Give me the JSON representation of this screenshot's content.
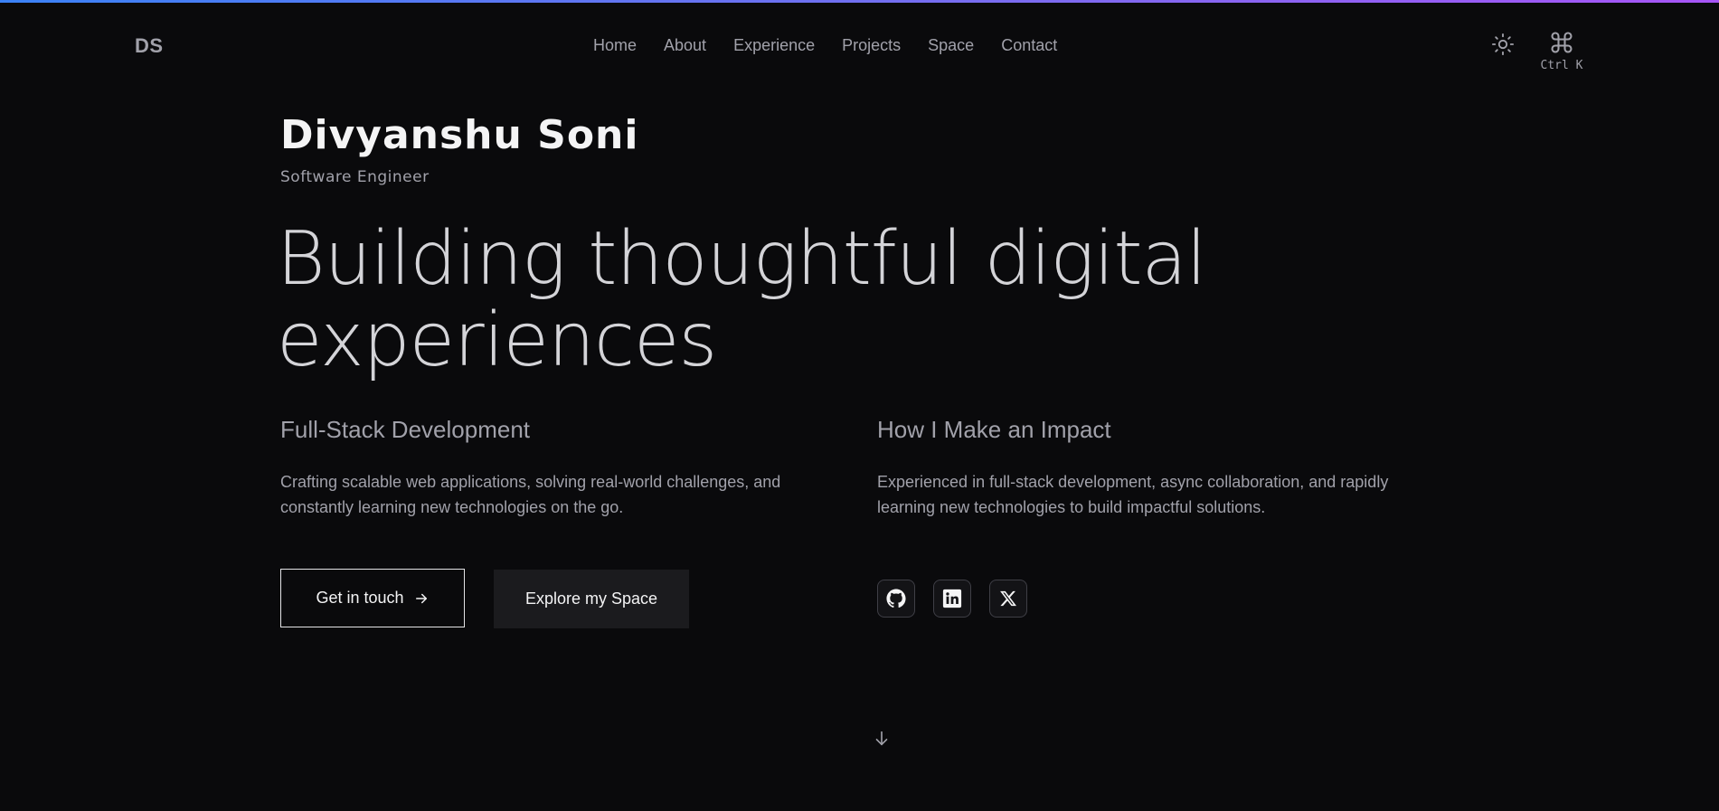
{
  "header": {
    "logo": "DS",
    "nav": [
      "Home",
      "About",
      "Experience",
      "Projects",
      "Space",
      "Contact"
    ],
    "theme_icon": "sun-icon",
    "command_icon": "command-icon",
    "command_shortcut": "Ctrl K"
  },
  "hero": {
    "name": "Divyanshu Soni",
    "role": "Software Engineer",
    "headline_line1": "Building thoughtful digital",
    "headline_line2": "experiences"
  },
  "columns": {
    "left": {
      "title": "Full-Stack Development",
      "body": "Crafting scalable web applications, solving real-world challenges, and constantly learning new technologies on the go."
    },
    "right": {
      "title": "How I Make an Impact",
      "body": "Experienced in full-stack development, async collaboration, and rapidly learning new technologies to build impactful solutions."
    }
  },
  "actions": {
    "get_in_touch": "Get in touch",
    "explore": "Explore my Space"
  },
  "socials": [
    "github-icon",
    "linkedin-icon",
    "x-icon"
  ],
  "colors": {
    "background": "#0a0a0c",
    "accent_gradient_start": "#3b82f6",
    "accent_gradient_end": "#a855f7",
    "text_primary": "#f4f4f5",
    "text_muted": "#a1a1aa"
  }
}
